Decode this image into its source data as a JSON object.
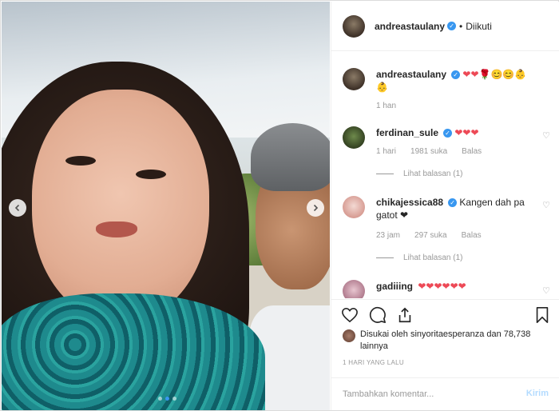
{
  "header": {
    "username": "andreastaulany",
    "separator": "•",
    "follow_status": "Diikuti"
  },
  "caption": {
    "username": "andreastaulany",
    "text": "❤❤🌹😊😊👶 👶",
    "time": "1 han"
  },
  "comments": [
    {
      "username": "ferdinan_sule",
      "text": "❤❤❤",
      "time": "1 hari",
      "likes": "1981 suka",
      "reply": "Balas",
      "replies": "Lihat balasan (1)"
    },
    {
      "username": "chikajessica88",
      "text": "Kangen dah pa gatot ❤",
      "time": "23 jam",
      "likes": "297 suka",
      "reply": "Balas",
      "replies": "Lihat balasan (1)"
    },
    {
      "username": "gadiiing",
      "text": "❤❤❤❤❤❤"
    }
  ],
  "likes_text": "Disukai oleh sinyoritaesperanza dan 78,738 lainnya",
  "timestamp": "1 HARI YANG LALU",
  "composer": {
    "placeholder": "Tambahkan komentar...",
    "post_label": "Kirim"
  },
  "carousel": {
    "count": 3,
    "active_index": 1
  },
  "colors": {
    "verified": "#3897f0",
    "heart": "#ed4956",
    "post_disabled": "#b3dbff"
  }
}
